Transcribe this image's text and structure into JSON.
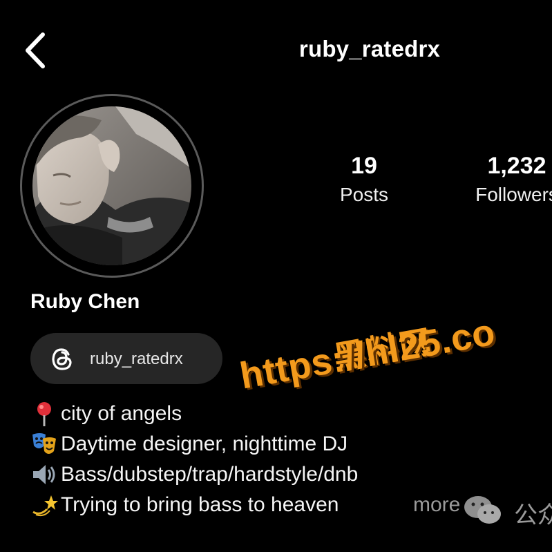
{
  "header": {
    "username": "ruby_ratedrx",
    "back_icon": "chevron-left-icon"
  },
  "profile": {
    "display_name": "Ruby Chen",
    "avatar_icon": "profile-photo"
  },
  "stats": {
    "posts_count": "19",
    "posts_label": "Posts",
    "followers_count": "1,232",
    "followers_label": "Followers"
  },
  "threads": {
    "handle": "ruby_ratedrx",
    "icon": "threads-icon"
  },
  "bio": [
    {
      "emoji": "pin-emoji",
      "text": "city of angels"
    },
    {
      "emoji": "theater-masks-emoji",
      "text": "Daytime designer, nighttime DJ"
    },
    {
      "emoji": "speaker-emoji",
      "text": "Bass/dubstep/trap/hardstyle/dnb"
    },
    {
      "emoji": "dizzy-emoji",
      "text": "Trying to bring bass to heaven"
    }
  ],
  "more_label": "more",
  "watermark": {
    "cn": "黑料网",
    "url": "https://hl25.co",
    "color": "#f39a1c"
  },
  "wechat": {
    "text": "公众",
    "icon": "wechat-icon"
  },
  "colors": {
    "background": "#000000",
    "pill_background": "#262626",
    "muted_text": "#9a9a9a"
  }
}
